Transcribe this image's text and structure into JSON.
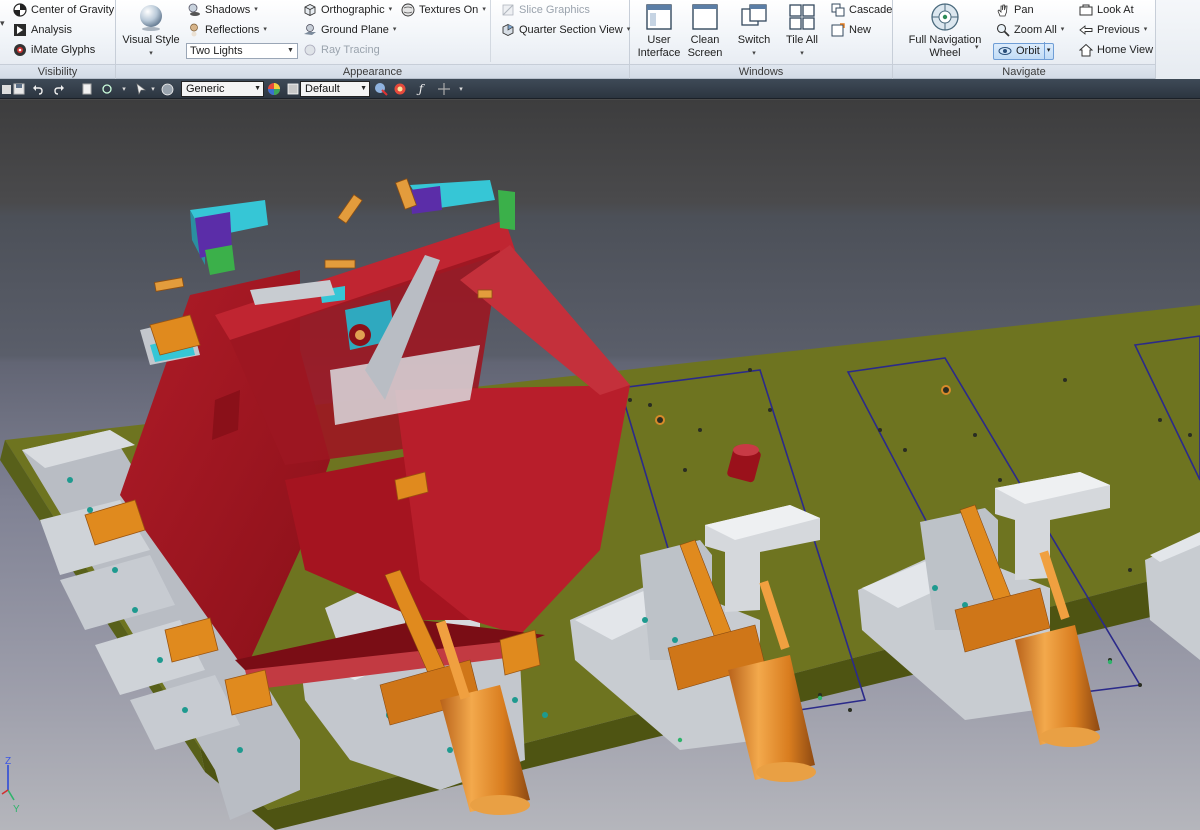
{
  "ribbon": {
    "visibility": {
      "title": "Visibility",
      "items": [
        {
          "label": "Center of Gravity",
          "icon": "center-of-gravity-icon"
        },
        {
          "label": "Analysis",
          "icon": "analysis-icon"
        },
        {
          "label": "iMate Glyphs",
          "icon": "imate-glyphs-icon"
        }
      ]
    },
    "appearance": {
      "title": "Appearance",
      "visual_style": "Visual Style",
      "shadows": "Shadows",
      "reflections": "Reflections",
      "lighting_value": "Two Lights",
      "orthographic": "Orthographic",
      "ground_plane": "Ground Plane",
      "ray_tracing": "Ray Tracing",
      "textures_on": "Textures On",
      "slice_graphics": "Slice Graphics",
      "quarter_section_view": "Quarter Section View"
    },
    "windows": {
      "title": "Windows",
      "user_interface": [
        "User",
        "Interface"
      ],
      "clean_screen": [
        "Clean",
        "Screen"
      ],
      "switch": "Switch",
      "tile_all": "Tile All",
      "cascade": "Cascade",
      "new": "New"
    },
    "navigate": {
      "title": "Navigate",
      "full_navigation_wheel": [
        "Full Navigation",
        "Wheel"
      ],
      "pan": "Pan",
      "zoom_all": "Zoom All",
      "orbit": "Orbit",
      "look_at": "Look At",
      "previous": "Previous",
      "home_view": "Home View"
    }
  },
  "qat": {
    "material_value": "Generic",
    "appearance_value": "Default"
  },
  "viewport": {
    "axis_labels": {
      "z": "Z",
      "y": "Y"
    }
  },
  "colors": {
    "accent_selected": "#6f9ed6",
    "body_red": "#a51420",
    "plate_olive": "#6e7420",
    "clamp_orange": "#e08a1e",
    "steel_gray": "#c9cdd2",
    "block_cyan": "#36c6d6"
  }
}
